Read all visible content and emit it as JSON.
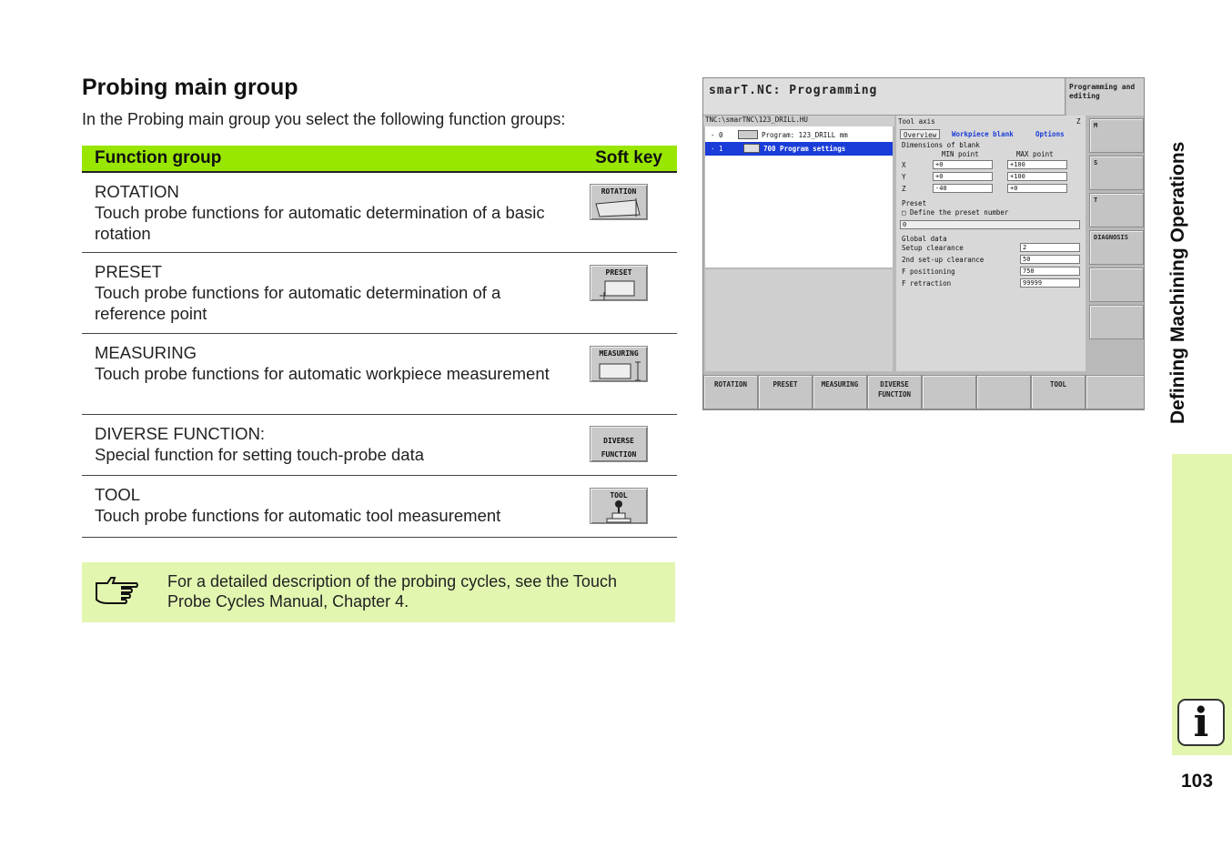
{
  "page": {
    "title": "Probing main group",
    "intro": "In the Probing main group you select the following function groups:",
    "side_title": "Defining Machining Operations",
    "page_number": "103",
    "info_icon": "info-icon"
  },
  "table": {
    "col_function_group": "Function group",
    "col_soft_key": "Soft key",
    "rows": [
      {
        "name": "ROTATION",
        "desc": "Touch probe functions for automatic determination of a basic rotation",
        "key": "ROTATION"
      },
      {
        "name": "PRESET",
        "desc": "Touch probe functions for automatic determination of a reference point",
        "key": "PRESET"
      },
      {
        "name": "MEASURING",
        "desc": "Touch probe functions for automatic workpiece measurement",
        "key": "MEASURING"
      },
      {
        "name": "DIVERSE FUNCTION:",
        "desc": "Special function for setting touch-probe data",
        "key": "DIVERSE FUNCTION"
      },
      {
        "name": "TOOL",
        "desc": "Touch probe functions for automatic tool measurement",
        "key": "TOOL"
      }
    ]
  },
  "note": {
    "icon": "pointing-hand-icon",
    "text": "For a detailed description of the probing cycles, see the Touch Probe Cycles Manual, Chapter 4."
  },
  "screen": {
    "title": "smarT.NC: Programming",
    "mode": "Programming and editing",
    "path": "TNC:\\smarTNC\\123_DRILL.HU",
    "tree": [
      {
        "idx": "- 0",
        "label": "Program: 123_DRILL mm"
      },
      {
        "idx": "· 1",
        "label": "700 Program settings"
      }
    ],
    "tool_axis_label": "Tool axis",
    "tool_axis_value": "Z",
    "tabs": [
      "Overview",
      "Workpiece blank",
      "Options"
    ],
    "blank_label": "Dimensions of blank",
    "min_point": "MIN point",
    "max_point": "MAX point",
    "axes": [
      {
        "axis": "X",
        "min": "+0",
        "max": "+100"
      },
      {
        "axis": "Y",
        "min": "+0",
        "max": "+100"
      },
      {
        "axis": "Z",
        "min": "-40",
        "max": "+0"
      }
    ],
    "preset_label": "Preset",
    "preset_checkbox": "Define the preset number",
    "preset_value": "0",
    "global_label": "Global data",
    "global": [
      {
        "label": "Setup clearance",
        "value": "2"
      },
      {
        "label": "2nd set-up clearance",
        "value": "50"
      },
      {
        "label": "F positioning",
        "value": "750"
      },
      {
        "label": "F retraction",
        "value": "99999"
      }
    ],
    "vkeys": [
      "M",
      "S",
      "T",
      "DIAGNOSIS"
    ],
    "hkeys": [
      "ROTATION",
      "PRESET",
      "MEASURING",
      "DIVERSE FUNCTION",
      "",
      "",
      "TOOL",
      ""
    ]
  }
}
